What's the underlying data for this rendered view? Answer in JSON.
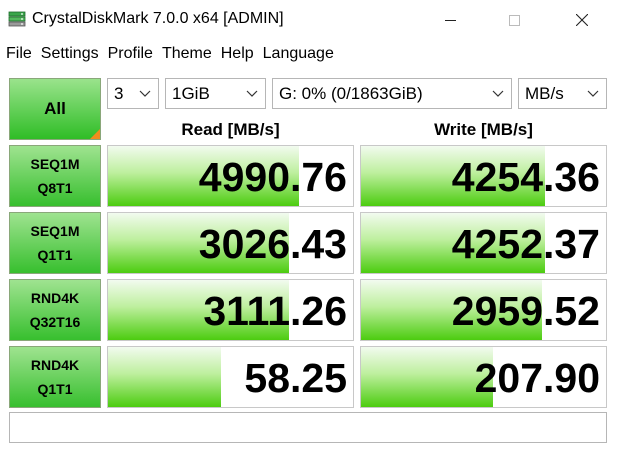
{
  "window": {
    "title": "CrystalDiskMark 7.0.0 x64 [ADMIN]",
    "minimize_glyph": "—",
    "maximize_glyph": "☐",
    "close_glyph": "✕"
  },
  "menu": [
    "File",
    "Settings",
    "Profile",
    "Theme",
    "Help",
    "Language"
  ],
  "controls": {
    "all_label": "All",
    "count": "3",
    "size": "1GiB",
    "drive": "G: 0% (0/1863GiB)",
    "unit": "MB/s"
  },
  "headers": {
    "read": "Read [MB/s]",
    "write": "Write [MB/s]"
  },
  "tests": [
    {
      "name1": "SEQ1M",
      "name2": "Q8T1",
      "read": "4990.76",
      "write": "4254.36",
      "read_fill": 0.78,
      "write_fill": 0.75
    },
    {
      "name1": "SEQ1M",
      "name2": "Q1T1",
      "read": "3026.43",
      "write": "4252.37",
      "read_fill": 0.74,
      "write_fill": 0.75
    },
    {
      "name1": "RND4K",
      "name2": "Q32T16",
      "read": "3111.26",
      "write": "2959.52",
      "read_fill": 0.74,
      "write_fill": 0.74
    },
    {
      "name1": "RND4K",
      "name2": "Q1T1",
      "read": "58.25",
      "write": "207.90",
      "read_fill": 0.46,
      "write_fill": 0.54
    }
  ],
  "comment": "",
  "colors": {
    "bar_green": "#4ccc10",
    "button_green": "#37bf2e",
    "corner_orange": "#f08c1e"
  },
  "icons": {
    "app": "disk-stack-icon",
    "dropdown": "chevron-down-icon"
  }
}
